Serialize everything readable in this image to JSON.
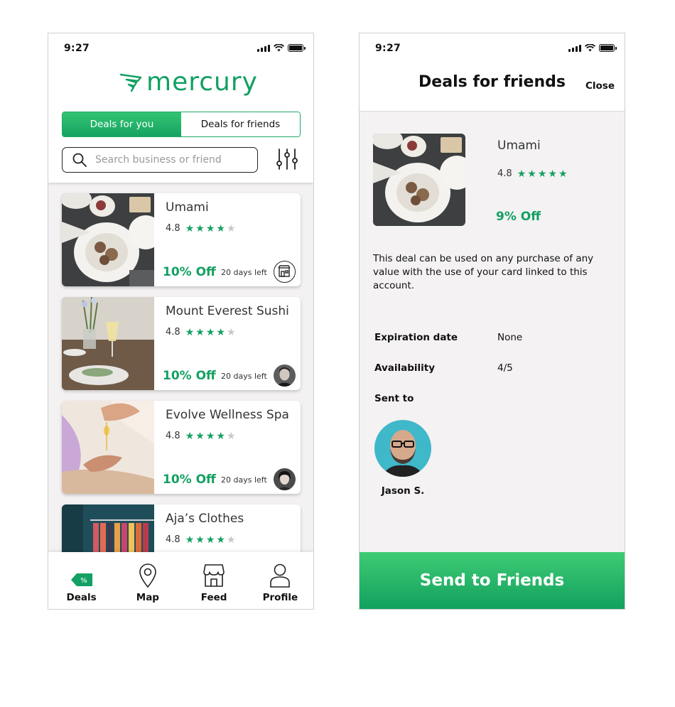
{
  "status_bar": {
    "time": "9:27"
  },
  "left": {
    "logo_text": "mercury",
    "segments": [
      "Deals for you",
      "Deals for friends"
    ],
    "search": {
      "placeholder": "Search business or friend"
    },
    "deals": [
      {
        "name": "Umami",
        "rating": "4.8",
        "stars": 4,
        "discount": "10% Off",
        "days_left": "20 days left",
        "badge": "store-icon"
      },
      {
        "name": "Mount Everest Sushi",
        "rating": "4.8",
        "stars": 4,
        "discount": "10% Off",
        "days_left": "20 days left",
        "badge": "friend-avatar"
      },
      {
        "name": "Evolve Wellness Spa",
        "rating": "4.8",
        "stars": 4,
        "discount": "10% Off",
        "days_left": "20 days left",
        "badge": "friend-avatar"
      },
      {
        "name": "Aja’s Clothes",
        "rating": "4.8",
        "stars": 4
      }
    ],
    "tabs": [
      {
        "label": "Deals",
        "icon": "deals-tag-icon"
      },
      {
        "label": "Map",
        "icon": "map-pin-icon"
      },
      {
        "label": "Feed",
        "icon": "storefront-icon"
      },
      {
        "label": "Profile",
        "icon": "profile-icon"
      }
    ]
  },
  "right": {
    "title": "Deals for friends",
    "close_label": "Close",
    "business": {
      "name": "Umami",
      "rating": "4.8",
      "stars": 5,
      "discount": "9% Off"
    },
    "description": "This deal can be used on any purchase of any value with the use of your card linked to this account.",
    "expiration": {
      "label": "Expiration date",
      "value": "None"
    },
    "availability": {
      "label": "Availability",
      "value": "4/5"
    },
    "sent_to": {
      "label": "Sent to",
      "friend_name": "Jason S."
    },
    "send_button": "Send to Friends"
  },
  "colors": {
    "brand_green": "#14a062",
    "star_off": "#c8c8c8"
  }
}
